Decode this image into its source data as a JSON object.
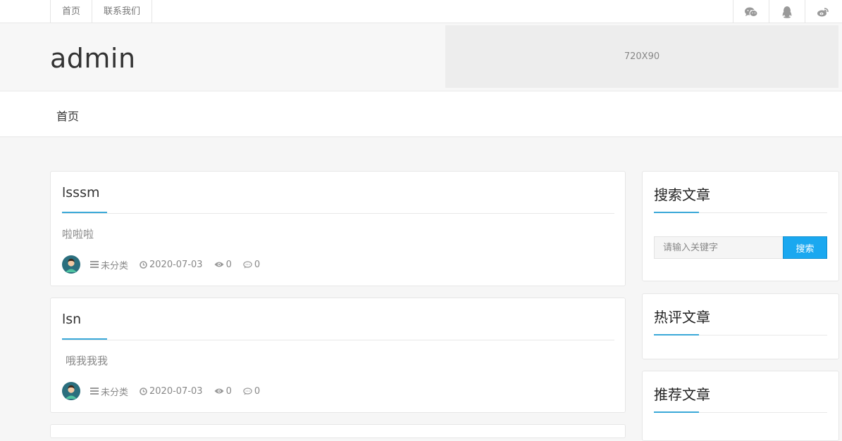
{
  "topbar": {
    "links": [
      "首页",
      "联系我们"
    ],
    "icons": [
      "wechat-icon",
      "qq-icon",
      "weibo-icon"
    ]
  },
  "header": {
    "site_title": "admin",
    "ad_text": "720X90"
  },
  "nav": {
    "items": [
      "首页"
    ]
  },
  "posts": [
    {
      "title": "lsssm",
      "excerpt": "啦啦啦",
      "category": "未分类",
      "date": "2020-07-03",
      "views": "0",
      "comments": "0"
    },
    {
      "title": "lsn",
      "excerpt": "哦我我我",
      "category": "未分类",
      "date": "2020-07-03",
      "views": "0",
      "comments": "0"
    }
  ],
  "sidebar": {
    "search": {
      "title": "搜索文章",
      "placeholder": "请输入关键字",
      "button": "搜索"
    },
    "hot": {
      "title": "热评文章"
    },
    "recommend": {
      "title": "推荐文章"
    }
  },
  "colors": {
    "accent": "#3aa8d8",
    "search_button": "#1aa8f0",
    "background": "#f6f6f6"
  }
}
